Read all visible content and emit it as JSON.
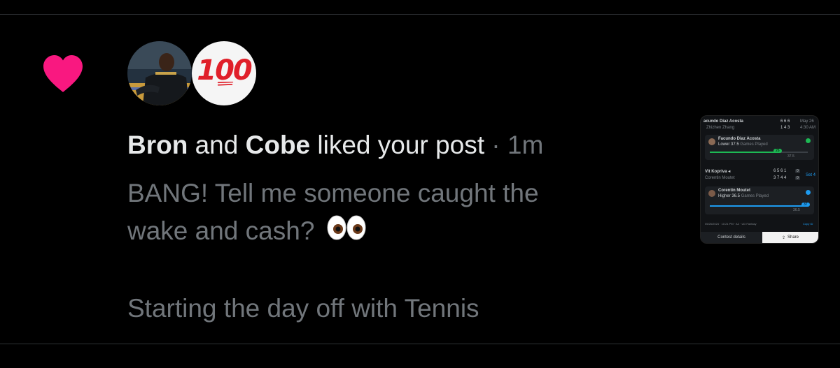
{
  "notification": {
    "type_icon": "heart-icon",
    "like_color": "#f91880",
    "avatars": [
      {
        "name": "Bron",
        "kind": "photo"
      },
      {
        "name": "Cobe",
        "kind": "emoji-100"
      }
    ],
    "headline": {
      "user1": "Bron",
      "joiner": "and",
      "user2": "Cobe",
      "action": "liked your post",
      "time": "· 1m"
    },
    "post_text_line1": "BANG! Tell me someone caught the",
    "post_text_line2": "wake and cash?",
    "post_text_emoji": "eyes-emoji",
    "post_text_tail": "Starting the day off with Tennis"
  },
  "thumbnail": {
    "header": {
      "player1": "acundo Diaz Acosta",
      "player2": "Zhizhen Zhang",
      "score1": "6 6 6",
      "score2": "1 4 3",
      "date": "May 26",
      "time": "4:30 AM"
    },
    "pick1": {
      "name": "Facundo Diaz Acosta",
      "line": "Lower 37.5",
      "stat": "Games Played",
      "bubble": "26",
      "mark": "37.5",
      "status_color": "#1db954",
      "progress_pct": 69
    },
    "match2": {
      "player1": "Vit Kopriva ◂",
      "player2": "Corentin Moutet",
      "score1": "6 5 6 1",
      "score2": "3 7 4 4",
      "badge1": "0",
      "badge2": "0",
      "set": "Set 4"
    },
    "pick2": {
      "name": "Corentin Moutet",
      "line": "Higher 36.5",
      "stat": "Games Played",
      "bubble": "37",
      "mark": "36.5",
      "status_color": "#1d9bf0",
      "progress_pct": 98
    },
    "footer": {
      "meta": "05/26/2024 · 10:21 PM · A2 · UD Fantasy",
      "copy": "Copy ID",
      "contest_button": "Contest details",
      "share_button": "Share"
    }
  }
}
